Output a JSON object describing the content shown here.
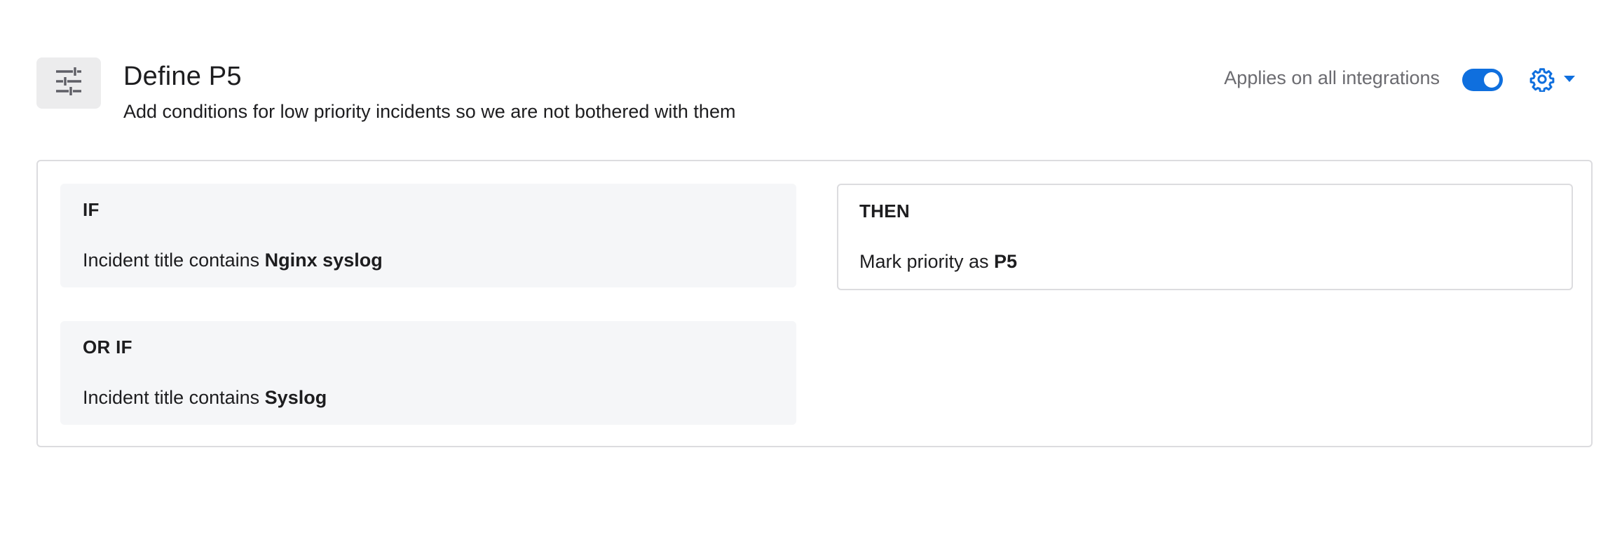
{
  "rule": {
    "icon": "sliders-icon",
    "title": "Define P5",
    "description": "Add conditions for low priority incidents so we are not bothered with them",
    "applies_label": "Applies on all integrations",
    "toggle_on": true,
    "settings_icon": "gear-icon",
    "dropdown_icon": "caret-down-icon"
  },
  "conditions": [
    {
      "heading": "IF",
      "prefix": "Incident title contains",
      "value": "Nginx syslog"
    },
    {
      "heading": "OR IF",
      "prefix": "Incident title contains",
      "value": "Syslog"
    }
  ],
  "action": {
    "heading": "THEN",
    "prefix": "Mark priority as",
    "value": "P5"
  },
  "colors": {
    "accent": "#0f6fde",
    "muted_text": "#6b6b70",
    "condition_bg": "#f5f6f8",
    "border": "#dcdcdf"
  }
}
